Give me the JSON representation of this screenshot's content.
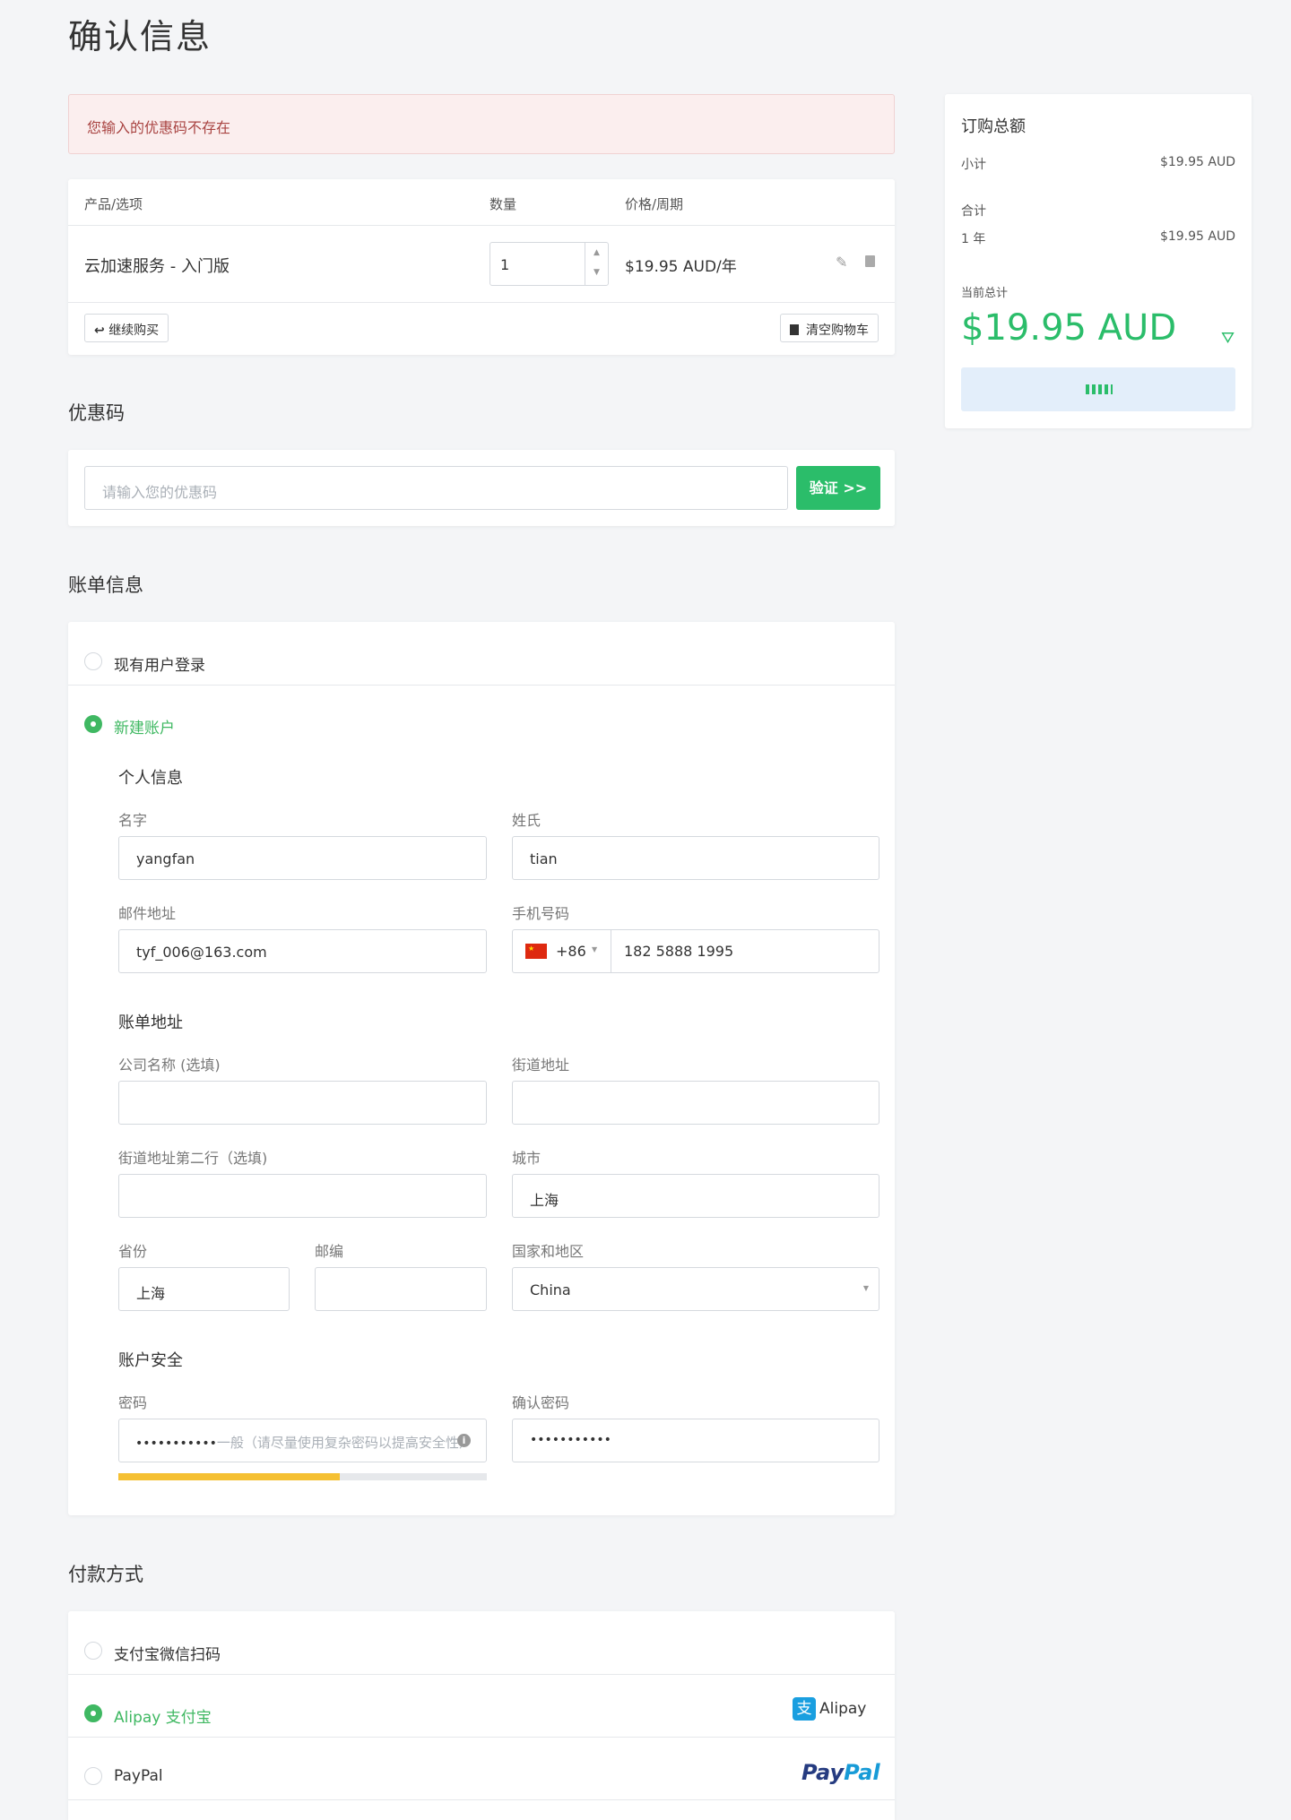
{
  "page_title": "确认信息",
  "alert": "您输入的优惠码不存在",
  "cart": {
    "columns": [
      "产品/选项",
      "数量",
      "价格/周期"
    ],
    "item_name": "云加速服务 - 入门版",
    "quantity": "1",
    "price": "$19.95 AUD/年",
    "continue_label": "继续购买",
    "clear_label": "清空购物车"
  },
  "summary": {
    "title": "订购总额",
    "subtotal_label": "小计",
    "subtotal_value": "$19.95 AUD",
    "total_label": "合计",
    "period_label": "1 年",
    "period_value": "$19.95 AUD",
    "current_total_label": "当前总计",
    "current_total": "$19.95 AUD"
  },
  "coupon": {
    "title": "优惠码",
    "placeholder": "请输入您的优惠码",
    "button": "验证 >>"
  },
  "billing": {
    "title": "账单信息",
    "existing_user": "现有用户登录",
    "new_account": "新建账户",
    "personal_title": "个人信息",
    "first_name_label": "名字",
    "first_name": "yangfan",
    "last_name_label": "姓氏",
    "last_name": "tian",
    "email_label": "邮件地址",
    "email": "tyf_006@163.com",
    "phone_label": "手机号码",
    "phone_code": "+86",
    "phone": "182 5888 1995",
    "address_title": "账单地址",
    "company_label": "公司名称 (选填)",
    "street_label": "街道地址",
    "street2_label": "街道地址第二行（选填)",
    "city_label": "城市",
    "city": "上海",
    "province_label": "省份",
    "province": "上海",
    "postcode_label": "邮编",
    "country_label": "国家和地区",
    "country": "China",
    "security_title": "账户安全",
    "password_label": "密码",
    "password_mask": "•••••••••••",
    "password_hint": "一般（请尽量使用复杂密码以提高安全性）",
    "password_strength": 0.6,
    "confirm_label": "确认密码",
    "confirm_mask": "•••••••••••"
  },
  "payment": {
    "title": "付款方式",
    "options": [
      "支付宝微信扫码",
      "Alipay 支付宝",
      "PayPal"
    ],
    "alipay_logo_text": "Alipay",
    "paypal_logo_text_1": "Pay",
    "paypal_logo_text_2": "Pal"
  },
  "colors": {
    "accent_green": "#2bbd6a",
    "alert_bg": "#fbeeee",
    "strength": "#f5c033"
  }
}
